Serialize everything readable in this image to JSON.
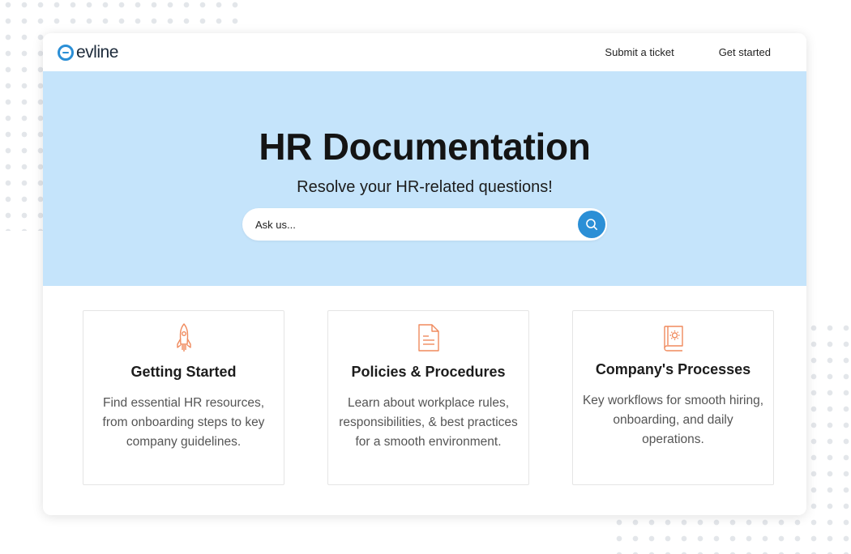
{
  "brand": {
    "name": "evline",
    "accent_color": "#2b8fd6"
  },
  "nav": {
    "links": [
      {
        "label": "Submit a ticket"
      },
      {
        "label": "Get started"
      }
    ]
  },
  "hero": {
    "title": "HR Documentation",
    "subtitle": "Resolve your HR-related questions!",
    "background": "#c5e4fb"
  },
  "search": {
    "placeholder": "Ask us...",
    "value": "",
    "icon": "search-icon"
  },
  "cards": [
    {
      "icon": "rocket-icon",
      "title": "Getting Started",
      "description": "Find essential HR resources, from onboarding steps to key company guidelines."
    },
    {
      "icon": "document-icon",
      "title": "Policies & Procedures",
      "description": "Learn about workplace rules, responsibilities, & best practices for a smooth environment."
    },
    {
      "icon": "gear-book-icon",
      "title": "Company's Processes",
      "description": "Key workflows for smooth hiring, onboarding, and daily operations."
    }
  ],
  "colors": {
    "icon_color": "#f08a5d",
    "text_dark": "#1c1c1c",
    "text_muted": "#555555"
  }
}
